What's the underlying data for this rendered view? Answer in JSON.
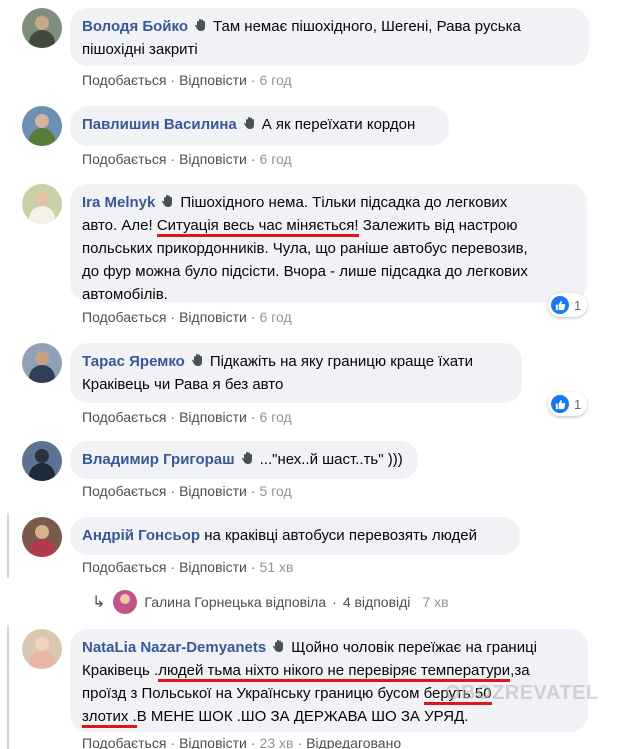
{
  "common": {
    "like_label": "Подобається",
    "reply_label": "Відповісти",
    "edited_label": "Відредаговано"
  },
  "comments": [
    {
      "author": "Володя Бойко",
      "lines": [
        "Там немає пішохідного, Шегені, Рава руська",
        "пішохідні закриті"
      ],
      "time": "6 год"
    },
    {
      "author": "Павлишин Василина",
      "lines": [
        "А як переїхати кордон"
      ],
      "time": "6 год"
    },
    {
      "author": "Ira Melnyk",
      "text_a": "Пішохідного нема. Тільки підсадка до легкових",
      "text_b": "авто. Але!",
      "text_b_underlined": "Ситуація весь час міняється!",
      "text_b_rest": "Залежить від настрою",
      "lines": [
        "польських прикордонників. Чула, що раніше автобус перевозив,",
        "до фур можна було підсісти. Вчора - лише підсадка до легкових",
        "автомобілів."
      ],
      "time": "6 год",
      "reactions": "1"
    },
    {
      "author": "Тарас Яремко",
      "lines": [
        "Підкажіть на яку границю краще їхати",
        "Краківець чи Рава я без авто"
      ],
      "time": "6 год",
      "reactions": "1"
    },
    {
      "author": "Владимир Григораш",
      "lines": [
        "...\"нех..й шаст..ть\" )))"
      ],
      "time": "5 год"
    },
    {
      "author": "Андрій Гонсьор",
      "lines": [
        "на краківці автобуси перевозять людей"
      ],
      "time": "51 хв"
    },
    {
      "author": "NataLia Nazar-Demyanets",
      "line1": "Щойно чоловік переїжає на границі",
      "line2_a": "Краківець .",
      "line2_u": "людей тьма ніхто нікого не перевіряє температури",
      "line2_b": ",за",
      "line3_a": "проїзд з Польської на Українську границю бусом",
      "line3_u": "беруть 50",
      "line4_u": "злотих .",
      "line4_b": "В МЕНЕ ШОК .ШО ЗА ДЕРЖАВА ШО ЗА УРЯД.",
      "time": "23 хв"
    }
  ],
  "reply_summary": {
    "arrow": "↳",
    "text": "Галина Горнецька відповіла",
    "dot": "·",
    "count": "4 відповіді",
    "time": "7 хв"
  },
  "watermark": "OBOZREVATEL",
  "colors": {
    "author": "#385898",
    "bubble": "#f0f2f5",
    "underline": "#e0151b",
    "like": "#1877f2"
  }
}
